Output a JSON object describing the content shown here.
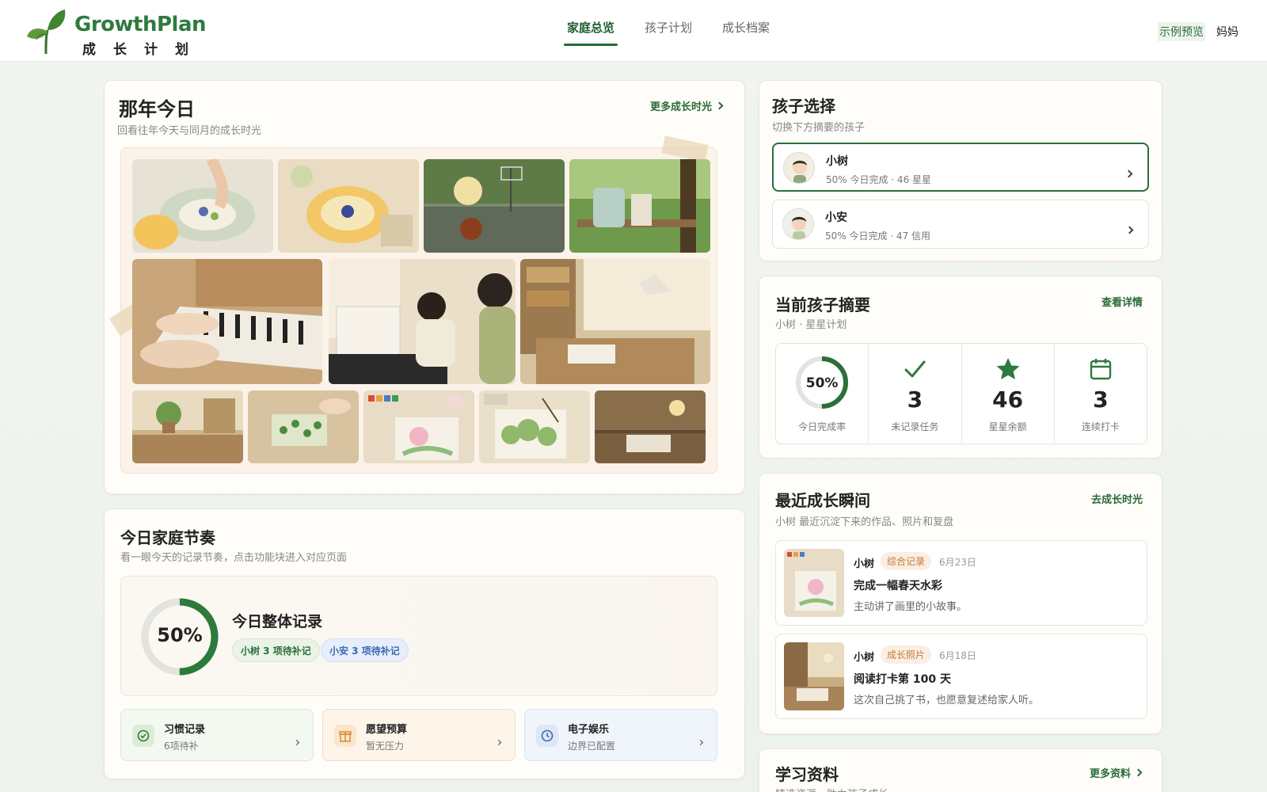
{
  "brand": {
    "name": "GrowthPlan",
    "subtitle": "成长计划"
  },
  "nav": {
    "items": [
      "家庭总览",
      "孩子计划",
      "成长档案"
    ],
    "active": 0
  },
  "header_right": {
    "preview_label": "示例预览",
    "user": "妈妈"
  },
  "memories": {
    "title": "那年今日",
    "subtitle": "回看往年今天与同月的成长时光",
    "link": "更多成长时光"
  },
  "child_select": {
    "title": "孩子选择",
    "subtitle": "切换下方摘要的孩子",
    "children": [
      {
        "name": "小树",
        "meta": "50% 今日完成 · 46 星星",
        "selected": true
      },
      {
        "name": "小安",
        "meta": "50% 今日完成 · 47 信用",
        "selected": false
      }
    ]
  },
  "summary": {
    "title": "当前孩子摘要",
    "subtitle": "小树 · 星星计划",
    "link": "查看详情",
    "completion_pct": 50,
    "completion_text": "50%",
    "completion_label": "今日完成率",
    "stats": [
      {
        "icon": "check-icon",
        "value": "3",
        "label": "未记录任务"
      },
      {
        "icon": "star-icon",
        "value": "46",
        "label": "星星余额"
      },
      {
        "icon": "calendar-icon",
        "value": "3",
        "label": "连续打卡"
      }
    ]
  },
  "moments": {
    "title": "最近成长瞬间",
    "subtitle": "小树 最近沉淀下来的作品、照片和复盘",
    "link": "去成长时光",
    "items": [
      {
        "name": "小树",
        "tag": "综合记录",
        "date": "6月23日",
        "title": "完成一幅春天水彩",
        "desc": "主动讲了画里的小故事。"
      },
      {
        "name": "小树",
        "tag": "成长照片",
        "date": "6月18日",
        "title": "阅读打卡第 100 天",
        "desc": "这次自己挑了书，也愿意复述给家人听。"
      }
    ]
  },
  "rhythm": {
    "title": "今日家庭节奏",
    "subtitle": "看一眼今天的记录节奏，点击功能块进入对应页面",
    "overall_title": "今日整体记录",
    "overall_pct": 50,
    "overall_text": "50%",
    "pills": [
      "小树 3 项待补记",
      "小安 3 项待补记"
    ],
    "tiles": [
      {
        "icon": "check-circle-icon",
        "title": "习惯记录",
        "sub": "6项待补"
      },
      {
        "icon": "gift-icon",
        "title": "愿望预算",
        "sub": "暂无压力"
      },
      {
        "icon": "clock-icon",
        "title": "电子娱乐",
        "sub": "边界已配置"
      }
    ]
  },
  "study": {
    "title": "学习资料",
    "subtitle": "精选资源，助力孩子成长",
    "link": "更多资料"
  },
  "colors": {
    "accent": "#2d6e3b",
    "brand_green": "#2f7a3f",
    "star": "#2d7a3d",
    "ring_track": "#e3e3e0"
  }
}
